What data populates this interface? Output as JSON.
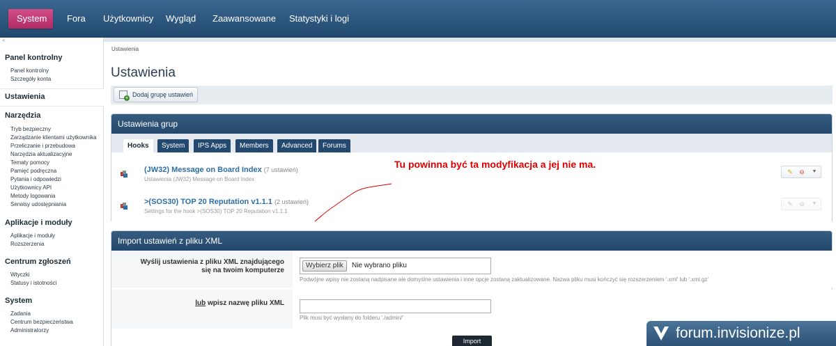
{
  "topnav": {
    "tabs": [
      "System",
      "Fora",
      "Użytkownicy",
      "Wygląd",
      "Zaawansowane",
      "Statystyki i logi"
    ],
    "active": "System"
  },
  "sidebar": {
    "collapse_icon": "«",
    "sections": [
      {
        "title": "Panel kontrolny",
        "items": [
          "Panel kontrolny",
          "Szczegóły konta"
        ]
      },
      {
        "title": "Ustawienia",
        "items": []
      },
      {
        "title": "Narzędzia",
        "items": [
          "Tryb bezpieczny",
          "Zarządzanie klientami użytkownika",
          "Przeliczanie i przebudowa",
          "Narzędzia aktualizacyjne",
          "Tematy pomocy",
          "Pamięć podręczna",
          "Pytania i odpowiedzi",
          "Użytkownicy API",
          "Metody logowania",
          "Serwisy udostępniania"
        ]
      },
      {
        "title": "Aplikacje i moduły",
        "items": [
          "Aplikacje i moduły",
          "Rozszerzenia"
        ]
      },
      {
        "title": "Centrum zgłoszeń",
        "items": [
          "Wtyczki",
          "Statusy i istotności"
        ]
      },
      {
        "title": "System",
        "items": [
          "Zadania",
          "Centrum bezpieczeństwa",
          "Administratorzy"
        ]
      }
    ],
    "active_section": "Ustawienia"
  },
  "breadcrumb": "Ustawienia",
  "page_title": "Ustawienia",
  "toolbar": {
    "add_group_label": "Dodaj grupę ustawień"
  },
  "groups_panel": {
    "title": "Ustawienia grup",
    "tabs": [
      "Hooks",
      "System",
      "IPS Apps",
      "Members",
      "Advanced",
      "Forums"
    ],
    "active_tab": "Hooks",
    "rows": [
      {
        "title": "(JW32) Message on Board Index",
        "count": "(7 ustawień)",
        "desc": "Ustawienia (JW32) Message on Board Index"
      },
      {
        "title": ">(SOS30) TOP 20 Reputation v1.1.1",
        "count": "(2 ustawień)",
        "desc": "Settings for the hook >(SOS30) TOP 20 Reputation v1.1.1"
      }
    ]
  },
  "annotation": "Tu powinna być ta modyfikacja a jej nie ma.",
  "import_panel": {
    "title": "Import ustawień z pliku XML",
    "upload_label_1": "Wyślij ustawienia z pliku XML znajdującego",
    "upload_label_2": "się na twoim komputerze",
    "file_button": "Wybierz plik",
    "file_status": "Nie wybrano pliku",
    "upload_hint": "Podwójne wpisy nie zostaną nadpisane ale domyślne ustawienia i inne opcje zostaną zaktualizowane. Nazwa pliku musi kończyć się rozszerzeniem '.xml' lub '.xml.gz'",
    "or_label": "lub",
    "filename_label": "wpisz nazwę pliku XML",
    "filename_hint": "Plik musi być wysłany do folderu './admin/'",
    "import_button": "Import"
  },
  "watermark": "forum.invisionize.pl",
  "colors": {
    "accent": "#c23a75",
    "nav": "#2b5279",
    "link": "#2b6ea8",
    "annotation": "#e00000"
  }
}
